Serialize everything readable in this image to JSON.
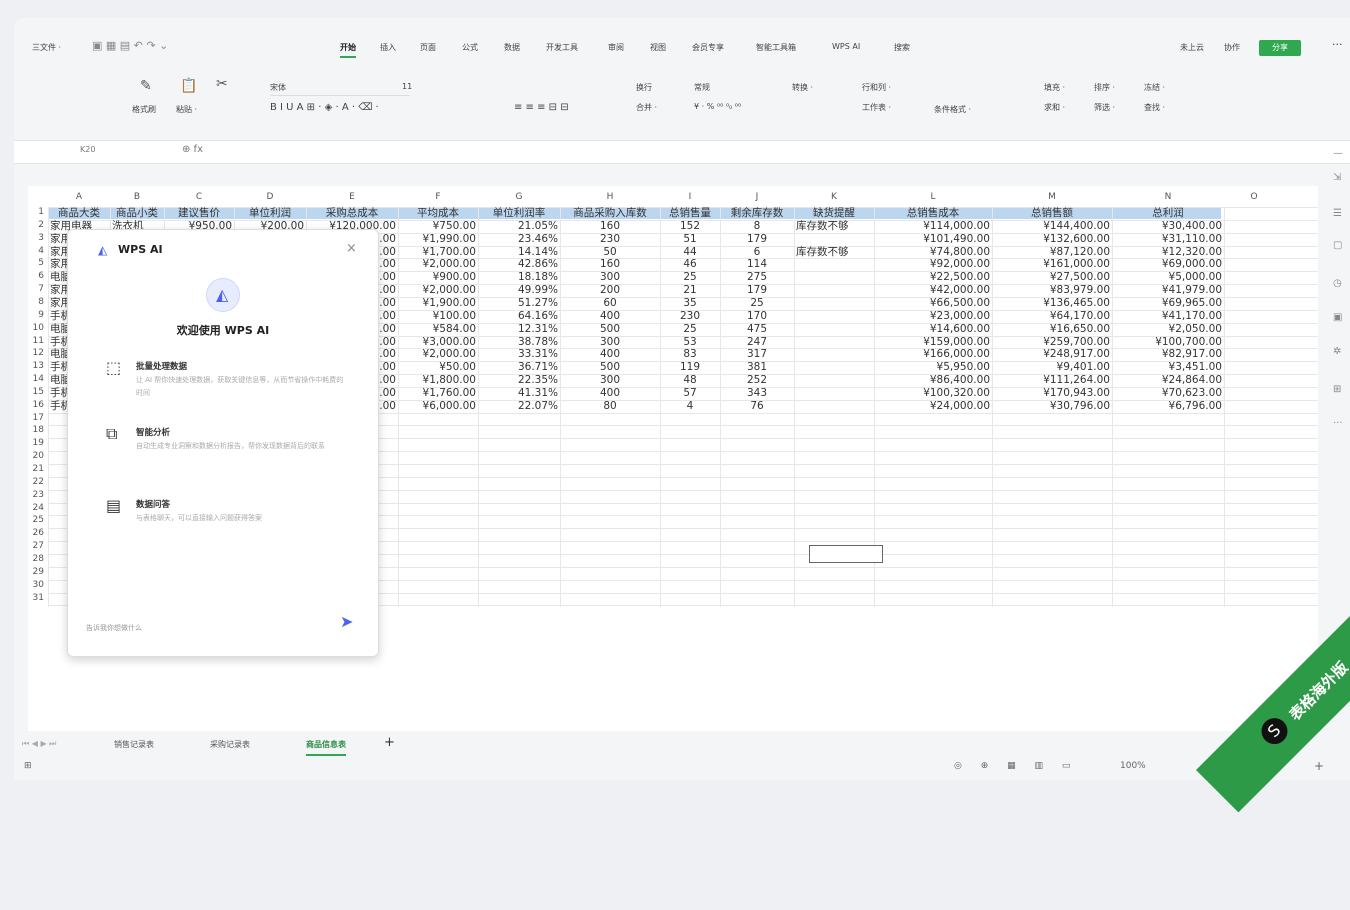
{
  "topbar": {
    "file_menu": "三文件 ·",
    "tools": "▣ ▦ ▤ ↶ ↷ ⌄",
    "tabs": [
      "开始",
      "插入",
      "页面",
      "公式",
      "数据",
      "开发工具",
      "审阅",
      "视图",
      "会员专享",
      "智能工具箱",
      "WPS AI",
      "搜索"
    ],
    "right_items": [
      "未上云",
      "协作"
    ],
    "share_label": "分享",
    "more": "···"
  },
  "ribbon": {
    "format_painter": "格式刷",
    "paste": "粘贴 ·",
    "font_name": "宋体",
    "font_size": "11",
    "font_icons": "B  I  U  A  ⊞ ·  ◈ ·  A ·  ⌫ ·",
    "align_icons": "≡  ≡  ≡  ⊟  ⊟",
    "wrap": "换行",
    "merge": "合并 ·",
    "number_format": "常规",
    "pct_icons": "¥ · % ⁰⁰ ⁰₀ ⁰⁰",
    "convert": "转换 ·",
    "row_col": "行和列 ·",
    "worksheet": "工作表 ·",
    "cond_format": "条件格式 ·",
    "fill": "填充 ·",
    "sort": "排序 ·",
    "sum": "求和 ·",
    "filter": "筛选 ·",
    "find": "查找 ·",
    "freeze": "冻结 ·"
  },
  "formula_bar": {
    "cell_ref": "K20",
    "fx": "⊕ fx"
  },
  "grid": {
    "columns": [
      "A",
      "B",
      "C",
      "D",
      "E",
      "F",
      "G",
      "H",
      "I",
      "J",
      "K",
      "L",
      "M",
      "N",
      "O"
    ],
    "rows": [
      "1",
      "2",
      "3",
      "4",
      "5",
      "6",
      "7",
      "8",
      "9",
      "10",
      "11",
      "12",
      "13",
      "14",
      "15",
      "16",
      "17",
      "18",
      "19",
      "20",
      "21",
      "22",
      "23",
      "24",
      "25",
      "26",
      "27",
      "28",
      "29",
      "30",
      "31"
    ],
    "header": [
      "商品大类",
      "商品小类",
      "建议售价",
      "单位利润",
      "采购总成本",
      "平均成本",
      "单位利润率",
      "商品采购入库数",
      "总销售量",
      "剩余库存数",
      "缺货提醒",
      "总销售成本",
      "总销售额",
      "总利润"
    ],
    "data": [
      [
        "家用电器",
        "洗衣机",
        "¥950.00",
        "¥200.00",
        "¥120,000.00",
        "¥750.00",
        "21.05%",
        "160",
        "152",
        "8",
        "库存数不够",
        "¥114,000.00",
        "¥144,400.00",
        "¥30,400.00"
      ],
      [
        "家用电",
        "",
        "",
        "",
        "0.00",
        "¥1,990.00",
        "23.46%",
        "230",
        "51",
        "179",
        "",
        "¥101,490.00",
        "¥132,600.00",
        "¥31,110.00"
      ],
      [
        "家用电",
        "",
        "",
        "",
        "0.00",
        "¥1,700.00",
        "14.14%",
        "50",
        "44",
        "6",
        "库存数不够",
        "¥74,800.00",
        "¥87,120.00",
        "¥12,320.00"
      ],
      [
        "家用电",
        "",
        "",
        "",
        "0.00",
        "¥2,000.00",
        "42.86%",
        "160",
        "46",
        "114",
        "",
        "¥92,000.00",
        "¥161,000.00",
        "¥69,000.00"
      ],
      [
        "电脑",
        "",
        "",
        "",
        "0.00",
        "¥900.00",
        "18.18%",
        "300",
        "25",
        "275",
        "",
        "¥22,500.00",
        "¥27,500.00",
        "¥5,000.00"
      ],
      [
        "家用电",
        "",
        "",
        "",
        "0.00",
        "¥2,000.00",
        "49.99%",
        "200",
        "21",
        "179",
        "",
        "¥42,000.00",
        "¥83,979.00",
        "¥41,979.00"
      ],
      [
        "家用电",
        "",
        "",
        "",
        "0.00",
        "¥1,900.00",
        "51.27%",
        "60",
        "35",
        "25",
        "",
        "¥66,500.00",
        "¥136,465.00",
        "¥69,965.00"
      ],
      [
        "手机",
        "",
        "",
        "",
        "0.00",
        "¥100.00",
        "64.16%",
        "400",
        "230",
        "170",
        "",
        "¥23,000.00",
        "¥64,170.00",
        "¥41,170.00"
      ],
      [
        "电脑",
        "",
        "",
        "",
        "0.00",
        "¥584.00",
        "12.31%",
        "500",
        "25",
        "475",
        "",
        "¥14,600.00",
        "¥16,650.00",
        "¥2,050.00"
      ],
      [
        "手机",
        "",
        "",
        "",
        "0.00",
        "¥3,000.00",
        "38.78%",
        "300",
        "53",
        "247",
        "",
        "¥159,000.00",
        "¥259,700.00",
        "¥100,700.00"
      ],
      [
        "电脑",
        "",
        "",
        "",
        "0.00",
        "¥2,000.00",
        "33.31%",
        "400",
        "83",
        "317",
        "",
        "¥166,000.00",
        "¥248,917.00",
        "¥82,917.00"
      ],
      [
        "手机",
        "",
        "",
        "",
        "0.00",
        "¥50.00",
        "36.71%",
        "500",
        "119",
        "381",
        "",
        "¥5,950.00",
        "¥9,401.00",
        "¥3,451.00"
      ],
      [
        "电脑",
        "",
        "",
        "",
        "0.00",
        "¥1,800.00",
        "22.35%",
        "300",
        "48",
        "252",
        "",
        "¥86,400.00",
        "¥111,264.00",
        "¥24,864.00"
      ],
      [
        "手机",
        "",
        "",
        "",
        "0.00",
        "¥1,760.00",
        "41.31%",
        "400",
        "57",
        "343",
        "",
        "¥100,320.00",
        "¥170,943.00",
        "¥70,623.00"
      ],
      [
        "手机",
        "",
        "",
        "",
        "0.00",
        "¥6,000.00",
        "22.07%",
        "80",
        "4",
        "76",
        "",
        "¥24,000.00",
        "¥30,796.00",
        "¥6,796.00"
      ]
    ]
  },
  "ai_panel": {
    "title": "WPS AI",
    "close": "×",
    "welcome": "欢迎使用 WPS AI",
    "features": [
      {
        "icon": "⬚",
        "title": "批量处理数据",
        "desc": "让 AI 帮你快速处理数据，获取关键信息等，从而节省操作中耗费的时间"
      },
      {
        "icon": "⧉",
        "title": "智能分析",
        "desc": "自动生成专业洞察和数据分析报告，帮你发现数据背后的联系"
      },
      {
        "icon": "▤",
        "title": "数据问答",
        "desc": "与表格聊天，可以直接输入问题获得答案"
      }
    ],
    "input_placeholder": "告诉我你想做什么",
    "send": "➤"
  },
  "sheets": {
    "nav": "⏮ ◀ ▶ ⏭",
    "tabs": [
      "销售记录表",
      "采购记录表",
      "商品信息表"
    ],
    "active": 2,
    "add": "+"
  },
  "status": {
    "left": "⊞",
    "zoom": "100%",
    "zoom_minus": "-",
    "zoom_plus": "+"
  },
  "banner": {
    "text": "表格海外版",
    "logo": "S"
  },
  "colors": {
    "accent": "#2fa84f",
    "header_fill": "#bcd6ef",
    "ai": "#4a62f0"
  }
}
